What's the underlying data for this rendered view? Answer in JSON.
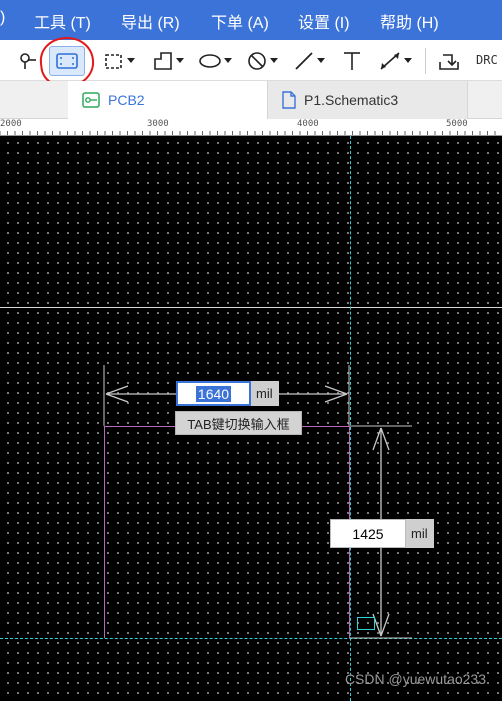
{
  "menu": {
    "items": [
      {
        "label": ")"
      },
      {
        "label": "工具 (T)"
      },
      {
        "label": "导出 (R)"
      },
      {
        "label": "下单 (A)"
      },
      {
        "label": "设置 (I)"
      },
      {
        "label": "帮助 (H)"
      }
    ]
  },
  "toolbar": {
    "tools": [
      {
        "icon": "pin-icon"
      },
      {
        "icon": "board-outline-rect-icon",
        "highlighted": true
      },
      {
        "icon": "dashed-rect-select-icon"
      },
      {
        "icon": "polygon-outline-icon"
      },
      {
        "icon": "ellipse-icon"
      },
      {
        "icon": "no-symbol-icon"
      },
      {
        "icon": "line-icon"
      },
      {
        "icon": "text-icon"
      },
      {
        "icon": "dimension-icon"
      },
      {
        "icon": "import-icon"
      }
    ],
    "drc_label": "DRC"
  },
  "tabs": [
    {
      "label": "PCB2",
      "active": true,
      "icon": "pcb-icon"
    },
    {
      "label": "P1.Schematic3",
      "active": false,
      "icon": "document-icon"
    }
  ],
  "ruler": {
    "labels": [
      "2000",
      "3000",
      "4000",
      "5000"
    ]
  },
  "canvas": {
    "width_value": "1640",
    "width_unit": "mil",
    "height_value": "1425",
    "height_unit": "mil",
    "hint": "TAB键切换输入框",
    "colors": {
      "background": "#000000",
      "board_edge": "#b86ab8",
      "crosshair": "#2fd2d8",
      "dimension": "#c8c8c8"
    }
  },
  "watermark": "CSDN @yuewutao233"
}
